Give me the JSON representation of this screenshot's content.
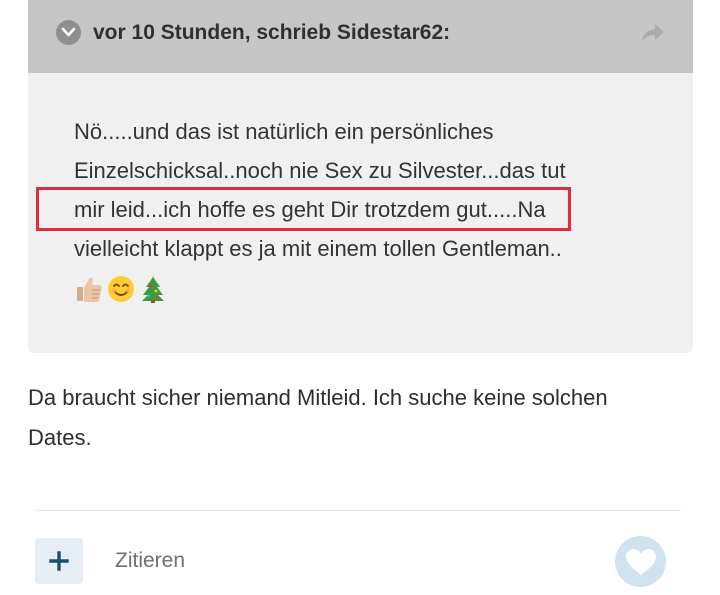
{
  "quote": {
    "attribution": "vor 10 Stunden, schrieb Sidestar62:",
    "lines": [
      "Nö.....und das ist natürlich ein persönliches",
      "Einzelschicksal..noch nie Sex zu Silvester...das tut",
      "mir leid...ich hoffe es geht Dir trotzdem gut.....Na",
      "vielleicht klappt es ja mit einem tollen Gentleman.."
    ],
    "emojis": [
      "thumbs-up-icon",
      "smiling-face-icon",
      "christmas-tree-icon"
    ]
  },
  "reply": {
    "lines": [
      "Da braucht sicher niemand Mitleid. Ich suche keine solchen",
      "Dates."
    ]
  },
  "actions": {
    "plus_symbol": "+",
    "quote_label": "Zitieren"
  },
  "colors": {
    "highlight": "#e8283f",
    "quote_header_bg": "#c6c6c6",
    "quote_body_bg": "#f0f0f0",
    "action_accent": "#1c4f6e"
  }
}
